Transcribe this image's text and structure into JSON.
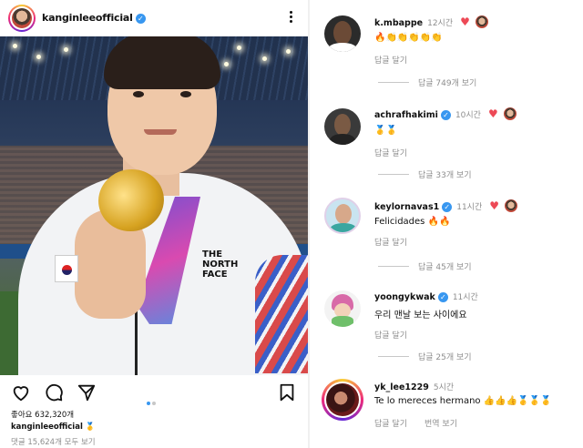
{
  "post": {
    "username": "kanginleeofficial",
    "verified_mark": "✓",
    "likes": "좋아요 632,320개",
    "caption_user": "kanginleeofficial",
    "caption_emoji": "🥇",
    "view_comments": "댓글 15,624개 모두 보기",
    "shirt_logo": [
      "THE",
      "NORTH",
      "FACE"
    ],
    "carousel_position": 1,
    "carousel_count": 2,
    "icons": [
      "more-icon",
      "heart-icon",
      "comment-icon",
      "share-icon",
      "bookmark-icon"
    ]
  },
  "comments": [
    {
      "username": "k.mbappe",
      "time": "12시간",
      "text": "🔥👏👏👏👏👏",
      "reply_label": "답글 달기",
      "replies": "답글 749개 보기",
      "avatar_color": "#2b2b2b"
    },
    {
      "username": "achrafhakimi",
      "time": "10시간",
      "text": "🥇🥇",
      "reply_label": "답글 달기",
      "replies": "답글 33개 보기",
      "avatar_color": "#3a3a3a"
    },
    {
      "username": "keylornavas1",
      "time": "11시간",
      "text": "Felicidades 🔥🔥",
      "reply_label": "답글 달기",
      "replies": "답글 45개 보기",
      "avatar_color": "#c9e4f0"
    },
    {
      "username": "yoongykwak",
      "time": "11시간",
      "text": "우리 맨날 보는 사이에요",
      "reply_label": "답글 달기",
      "replies": "답글 25개 보기",
      "avatar_color": "#f3f3f3"
    },
    {
      "username": "yk_lee1229",
      "time": "5시간",
      "text": "Te lo mereces hermano 👍👍👍🥇🥇🥇",
      "reply_label": "답글 달기",
      "translate_label": "번역 보기",
      "avatar_color": "#6a1a1a"
    }
  ],
  "colors": {
    "verified": "#3897f0",
    "heart": "#ed4956",
    "muted": "#8e8e8e"
  }
}
